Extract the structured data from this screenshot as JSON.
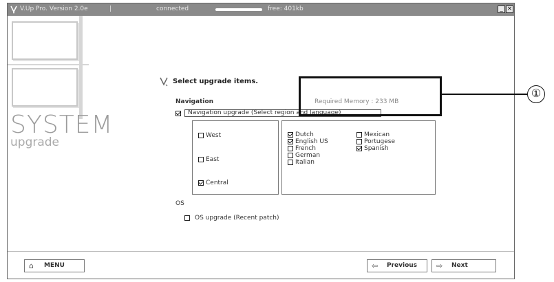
{
  "titlebar": {
    "app_title": "V.Up Pro. Version 2.0e",
    "separator": "|",
    "status": "connected",
    "free_text": "free: 401kb",
    "minimize_label": "_",
    "close_label": "×"
  },
  "sidebar": {
    "system_label": "SYSTEM",
    "upgrade_label": "upgrade"
  },
  "main": {
    "heading": "Select upgrade items.",
    "navigation_label": "Navigation",
    "required_memory": "Required Memory : 233 MB",
    "nav_upgrade": {
      "label": "Navigation upgrade (Select region and language)",
      "checked": true
    },
    "regions": [
      {
        "label": "West",
        "checked": false
      },
      {
        "label": "East",
        "checked": false
      },
      {
        "label": "Central",
        "checked": true
      }
    ],
    "languages_col1": [
      {
        "label": "Dutch",
        "checked": true
      },
      {
        "label": "English US",
        "checked": true
      },
      {
        "label": "French",
        "checked": false
      },
      {
        "label": "German",
        "checked": false
      },
      {
        "label": "Italian",
        "checked": false
      }
    ],
    "languages_col2": [
      {
        "label": "Mexican",
        "checked": false
      },
      {
        "label": "Portugese",
        "checked": false
      },
      {
        "label": "Spanish",
        "checked": true
      }
    ],
    "os_label": "OS",
    "os_upgrade": {
      "label": "OS upgrade (Recent patch)",
      "checked": false
    }
  },
  "footer": {
    "menu_label": "MENU",
    "previous_label": "Previous",
    "next_label": "Next"
  },
  "callout": {
    "number": "①"
  }
}
